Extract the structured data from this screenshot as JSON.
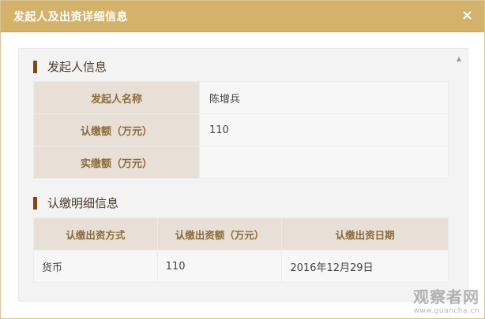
{
  "dialog": {
    "title": "发起人及出资详细信息",
    "close_label": "×"
  },
  "section1": {
    "heading": "发起人信息",
    "rows": [
      {
        "label": "发起人名称",
        "value": "陈增兵"
      },
      {
        "label": "认缴额（万元）",
        "value": "110"
      },
      {
        "label": "实缴额（万元）",
        "value": ""
      }
    ]
  },
  "section2": {
    "heading": "认缴明细信息",
    "columns": [
      "认缴出资方式",
      "认缴出资额（万元）",
      "认缴出资日期"
    ],
    "rows": [
      [
        "货币",
        "110",
        "2016年12月29日"
      ]
    ]
  },
  "scroll_up_icon": "▲",
  "watermark": {
    "main": "观察者网",
    "sub": "www.guancha.cn"
  },
  "colors": {
    "titlebar": "#d4b26a",
    "label_bg": "#e8e0d6",
    "label_text": "#8a6a3a",
    "section_bar": "#7a4a1a"
  }
}
